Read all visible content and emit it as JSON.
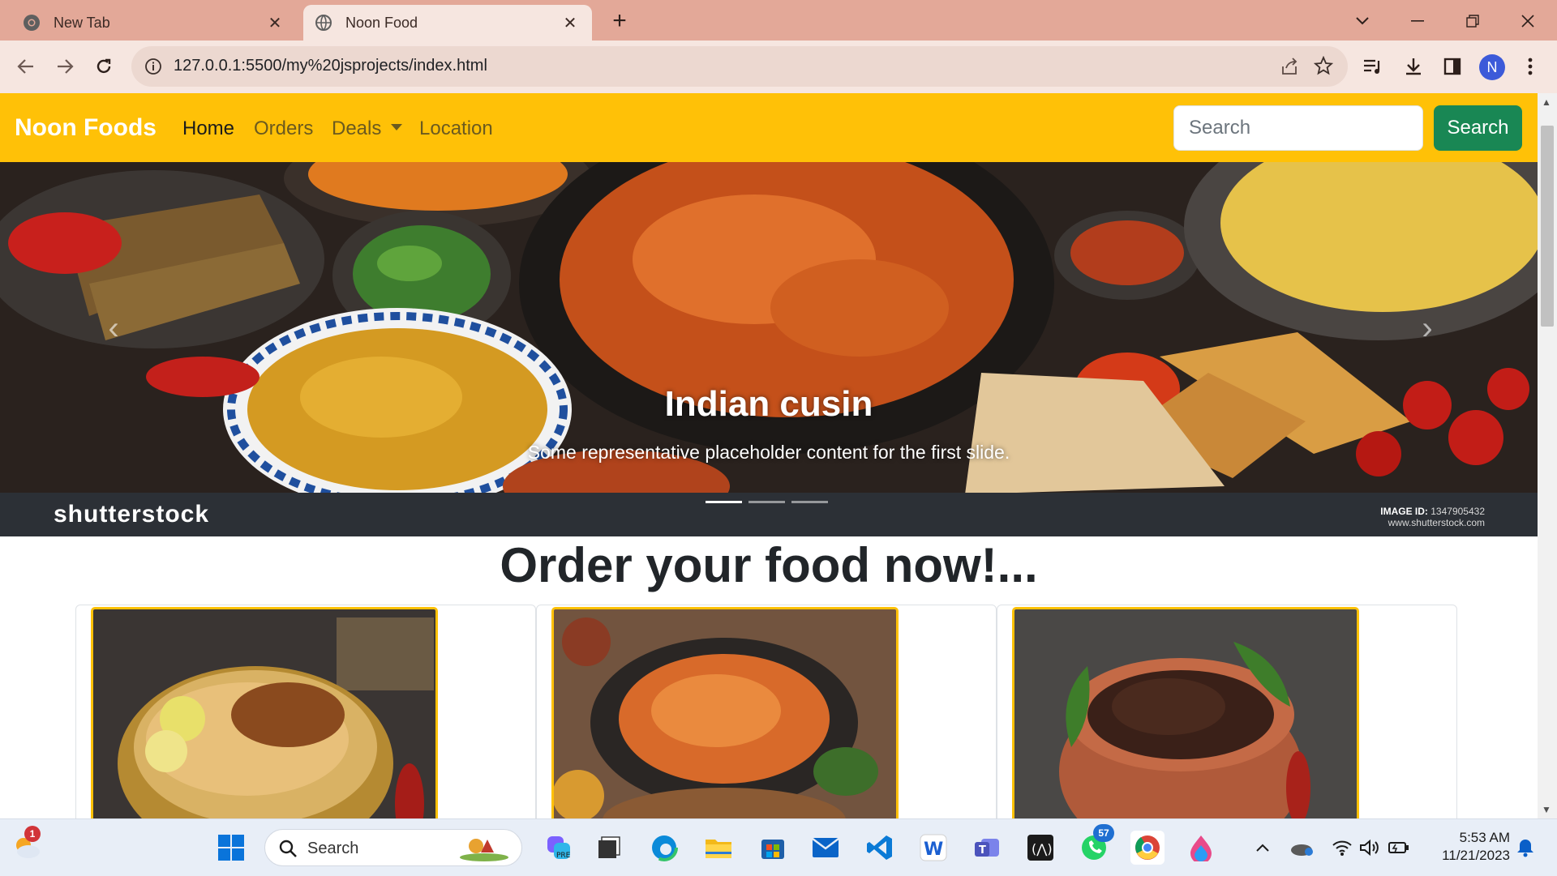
{
  "browser": {
    "tabs": [
      {
        "title": "New Tab",
        "active": false
      },
      {
        "title": "Noon Food",
        "active": true
      }
    ],
    "url": "127.0.0.1:5500/my%20jsprojects/index.html",
    "profile_initial": "N"
  },
  "navbar": {
    "brand": "Noon Foods",
    "links": [
      "Home",
      "Orders",
      "Deals",
      "Location"
    ],
    "active_link": "Home",
    "search_placeholder": "Search",
    "search_button": "Search",
    "brand_color": "#ffc107",
    "button_color": "#198754"
  },
  "carousel": {
    "title": "Indian cusin",
    "text": "Some representative placeholder content for the first slide.",
    "watermark_logo": "shutterstock",
    "image_id_label": "IMAGE ID:",
    "image_id": "1347905432",
    "watermark_site": "www.shutterstock.com",
    "indicator_count": 3,
    "active_indicator": 0
  },
  "main": {
    "heading": "Order your food now!..."
  },
  "taskbar": {
    "search_label": "Search",
    "time": "5:53 AM",
    "date": "11/21/2023",
    "whatsapp_badge": "57",
    "weather_badge": "1"
  }
}
